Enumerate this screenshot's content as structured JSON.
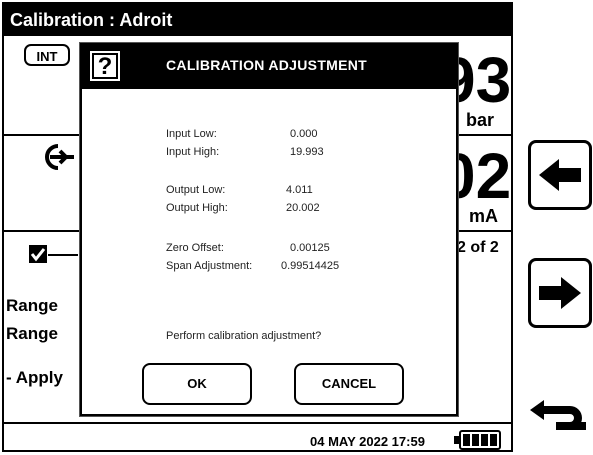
{
  "title": "Calibration : Adroit",
  "int_badge": "INT",
  "upper_value": "93",
  "upper_unit": "bar",
  "lower_value": "02",
  "lower_unit": "mA",
  "page_indicator": "2 of 2",
  "rows": [
    "Range",
    "Range",
    "- Apply"
  ],
  "status": {
    "datetime": "04 MAY 2022 17:59",
    "battery_cells": 4
  },
  "dialog": {
    "icon": "?",
    "title": "CALIBRATION  ADJUSTMENT",
    "fields": [
      {
        "label": "Input Low:",
        "value": "0.000"
      },
      {
        "label": "Input High:",
        "value": "19.993"
      },
      {
        "label": "Output Low:",
        "value": "4.011"
      },
      {
        "label": "Output High:",
        "value": "20.002"
      },
      {
        "label": "Zero Offset:",
        "value": "0.00125"
      },
      {
        "label": "Span Adjustment:",
        "value": "0.99514425"
      }
    ],
    "prompt": "Perform calibration adjustment?",
    "ok_label": "OK",
    "cancel_label": "CANCEL"
  },
  "icons": {
    "left": "left-arrow-icon",
    "right": "right-arrow-icon",
    "back": "return-arrow-icon",
    "input": "input-port-icon",
    "check": "checkbox-checked-icon",
    "battery": "battery-icon"
  }
}
